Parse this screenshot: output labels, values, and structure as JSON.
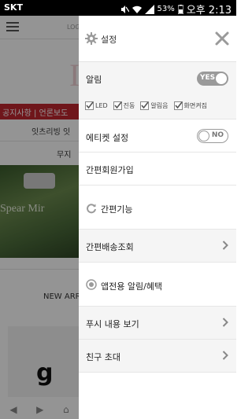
{
  "status_bar": {
    "carrier": "SKT",
    "battery": "53%",
    "time": "오후 2:13"
  },
  "background_page": {
    "logo_text": "LOG",
    "big_mark": "I",
    "notice": "공지사항 | 언론보도",
    "menu_1": "잇츠리빙  잇",
    "menu_2": "무지",
    "photo_text": "Spear Mir",
    "new_arrival": "NEW ARR",
    "product_glyph": "g"
  },
  "drawer": {
    "title": "설정",
    "alert_label": "알림",
    "alert_toggle": "YES",
    "checks": [
      {
        "label": "LED"
      },
      {
        "label": "진동"
      },
      {
        "label": "알림음"
      },
      {
        "label": "화면켜짐"
      }
    ],
    "etiquette_label": "에티켓 설정",
    "etiquette_toggle": "NO",
    "signup_label": "간편회원가입",
    "easy_label": "간편기능",
    "delivery_label": "간편배송조회",
    "app_label": "앱전용 알림/혜택",
    "push_label": "푸시 내용 보기",
    "invite_label": "친구 초대"
  },
  "colors": {
    "accent_red": "#c0262f",
    "toggle_gray": "#9a9a9a",
    "row_gray": "#f5f5f5"
  }
}
